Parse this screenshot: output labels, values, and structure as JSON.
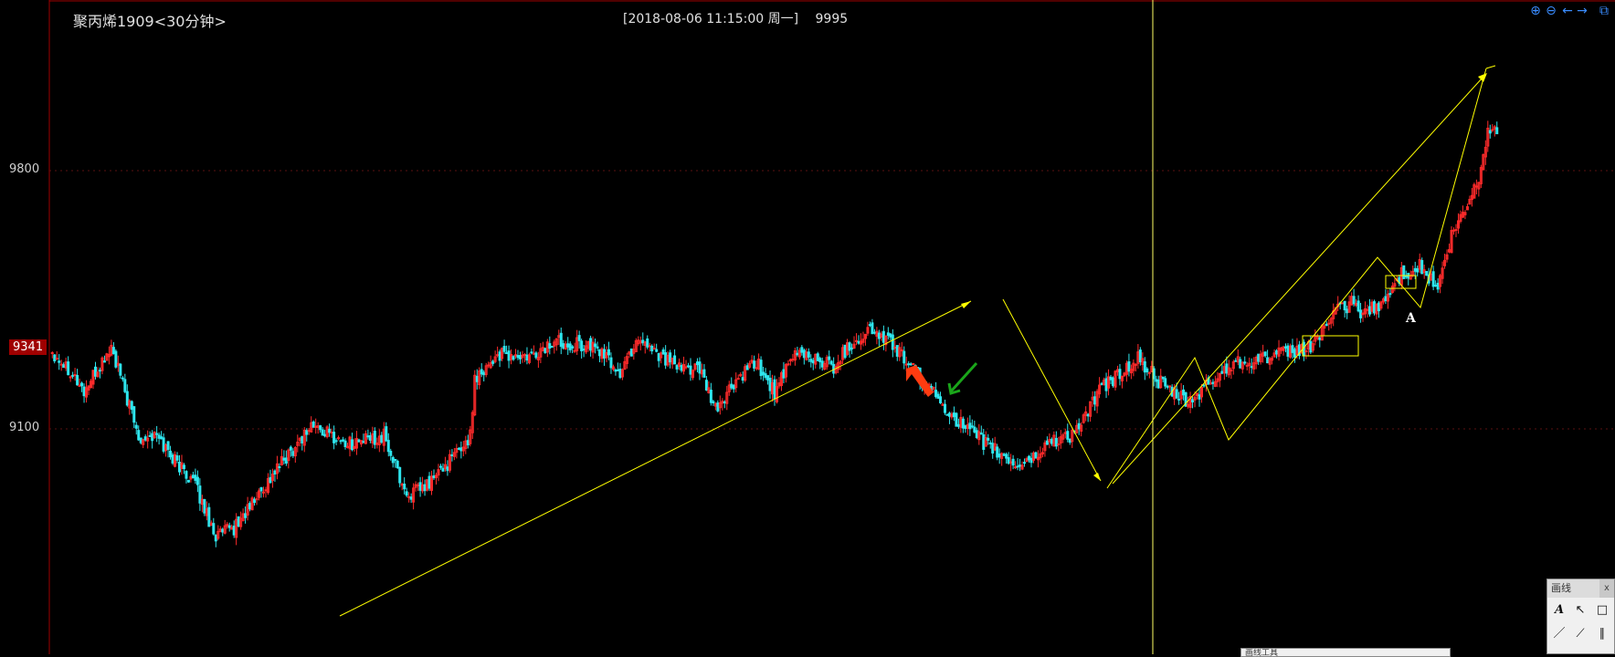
{
  "header": {
    "title": "聚丙烯1909<30分钟>",
    "datetime": "[2018-08-06  11:15:00 周一]",
    "price": "9995"
  },
  "price_axis": {
    "labels": [
      "9800",
      "9100"
    ],
    "current_price": "9341"
  },
  "annotation": {
    "text": "A"
  },
  "draw_panel": {
    "title": "画线",
    "close": "x"
  },
  "bottom_bar": {
    "label": "画线工具"
  },
  "colors": {
    "up": "#ff2b2b",
    "down": "#2ee6ee",
    "trend": "#ffff00",
    "crosshair": "#ffff66",
    "grid": "#5a1010",
    "frame": "#a00000"
  },
  "chart_data": {
    "type": "candlestick",
    "title": "聚丙烯1909<30分钟>",
    "ylabel": "",
    "xlabel": "",
    "ylim": [
      8750,
      9980
    ],
    "current_price": 9341,
    "crosshair": {
      "time": "2018-08-06 11:15:00",
      "price": 9995
    },
    "anchors": [
      [
        0,
        9310
      ],
      [
        8,
        9260
      ],
      [
        14,
        9200
      ],
      [
        22,
        9280
      ],
      [
        26,
        9320
      ],
      [
        38,
        9080
      ],
      [
        46,
        9080
      ],
      [
        56,
        9000
      ],
      [
        62,
        8960
      ],
      [
        72,
        8810
      ],
      [
        80,
        8830
      ],
      [
        100,
        9000
      ],
      [
        114,
        9110
      ],
      [
        130,
        9060
      ],
      [
        146,
        9080
      ],
      [
        156,
        8920
      ],
      [
        164,
        8940
      ],
      [
        176,
        9020
      ],
      [
        184,
        9080
      ],
      [
        186,
        9240
      ],
      [
        196,
        9300
      ],
      [
        210,
        9290
      ],
      [
        222,
        9340
      ],
      [
        240,
        9320
      ],
      [
        250,
        9250
      ],
      [
        258,
        9350
      ],
      [
        276,
        9260
      ],
      [
        284,
        9270
      ],
      [
        292,
        9150
      ],
      [
        300,
        9220
      ],
      [
        310,
        9280
      ],
      [
        318,
        9200
      ],
      [
        328,
        9310
      ],
      [
        344,
        9270
      ],
      [
        350,
        9320
      ],
      [
        360,
        9370
      ],
      [
        370,
        9330
      ],
      [
        384,
        9220
      ],
      [
        402,
        9100
      ],
      [
        424,
        9000
      ],
      [
        432,
        9020
      ],
      [
        440,
        9070
      ],
      [
        448,
        9080
      ],
      [
        456,
        9140
      ],
      [
        460,
        9200
      ],
      [
        478,
        9290
      ],
      [
        490,
        9210
      ],
      [
        500,
        9170
      ],
      [
        520,
        9280
      ],
      [
        540,
        9300
      ],
      [
        554,
        9320
      ],
      [
        560,
        9380
      ],
      [
        566,
        9420
      ],
      [
        572,
        9440
      ],
      [
        578,
        9410
      ],
      [
        584,
        9440
      ],
      [
        586,
        9440
      ],
      [
        594,
        9520
      ],
      [
        602,
        9540
      ],
      [
        610,
        9480
      ],
      [
        616,
        9620
      ],
      [
        622,
        9690
      ],
      [
        628,
        9780
      ],
      [
        632,
        9910
      ],
      [
        636,
        9900
      ]
    ]
  }
}
